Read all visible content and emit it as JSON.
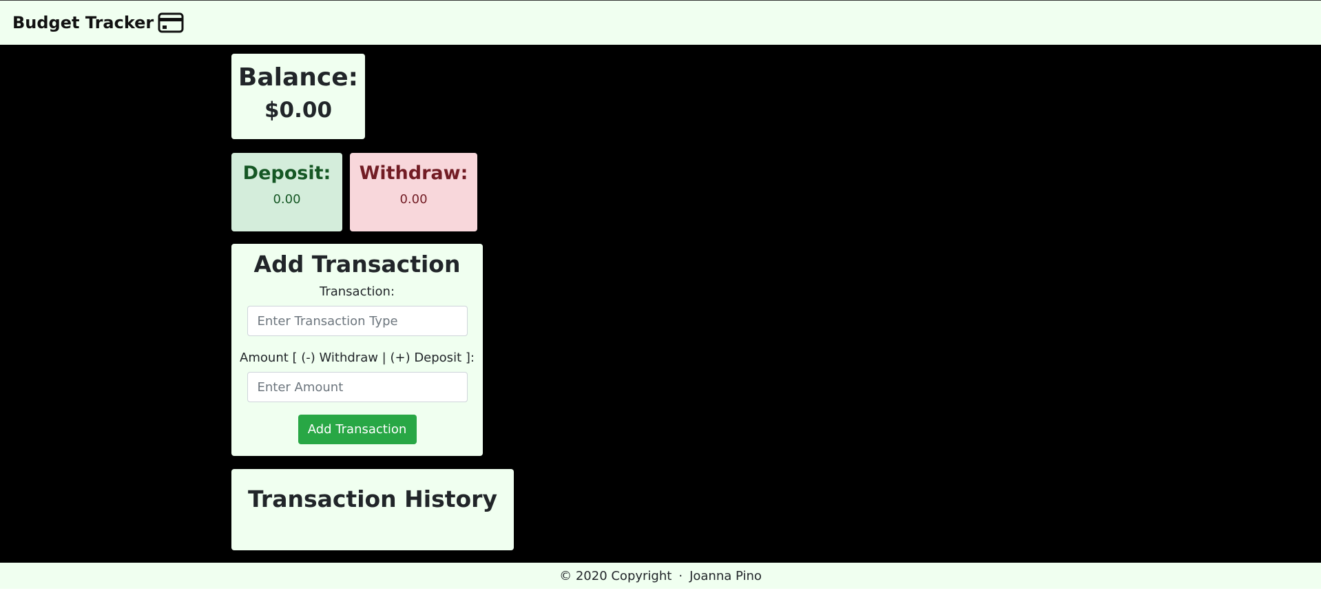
{
  "navbar": {
    "brand_title": "Budget Tracker",
    "brand_icon": "credit-card-icon"
  },
  "balance": {
    "label": "Balance:",
    "value": "$0.00"
  },
  "deposit": {
    "label": "Deposit:",
    "value": "0.00",
    "color": "#155724",
    "background": "#d4eddb"
  },
  "withdraw": {
    "label": "Withdraw:",
    "value": "0.00",
    "color": "#721c24",
    "background": "#f8d7db"
  },
  "add_transaction": {
    "title": "Add Transaction",
    "transaction_label": "Transaction:",
    "transaction_placeholder": "Enter Transaction Type",
    "transaction_value": "",
    "amount_label": "Amount [ (-) Withdraw | (+) Deposit ]:",
    "amount_placeholder": "Enter Amount",
    "amount_value": "",
    "button_label": "Add Transaction",
    "button_color": "#28a745"
  },
  "history": {
    "title": "Transaction History",
    "items": []
  },
  "footer": {
    "copyright": "© 2020 Copyright",
    "separator": "·",
    "author": "Joanna Pino"
  },
  "colors": {
    "header_bg": "#f0fff0",
    "main_bg": "#000000"
  }
}
